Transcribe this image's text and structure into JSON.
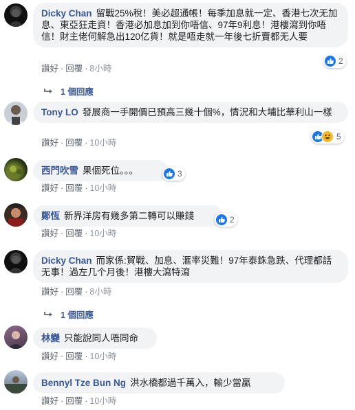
{
  "comments": [
    {
      "author": "Dicky Chan",
      "text": "留戰25%稅！美必超通帳！每季加息就一定、香港七次无加息、東亞狂走資！香港必加息加到你唔信、97年9利息！港樓瀉到你唔信！財主佬何解急出120亿貨！就是唔走就一年後七折賣都无人要",
      "like": "讚好",
      "reply": "回覆",
      "time": "8小時",
      "reactions": {
        "icons": [
          "like-icon"
        ],
        "count": "2"
      },
      "replies": "1 個回應"
    },
    {
      "author": "Tony LO",
      "text": "發展商一手開價已預高三幾十個%，情況和大埔比華利山一樣",
      "like": "讚好",
      "reply": "回覆",
      "time": "10小時",
      "reactions": {
        "icons": [
          "like-icon",
          "haha-icon"
        ],
        "count": "5"
      }
    },
    {
      "author": "西門吹雪",
      "text": "果個死位。。。",
      "like": "讚好",
      "reply": "回覆",
      "time": "10小時",
      "reactions": {
        "icons": [
          "like-icon"
        ],
        "count": "3"
      }
    },
    {
      "author": "鄭恆",
      "text": "新界洋房有幾多第二轉可以賺錢",
      "like": "讚好",
      "reply": "回覆",
      "time": "10小時",
      "reactions": {
        "icons": [
          "like-icon"
        ],
        "count": "2"
      }
    },
    {
      "author": "Dicky Chan",
      "text": "而家係:貿戰、加息、滙率災難！97年泰銖急跌、代理都話无事！過左几个月後！港樓大瀉特瀉",
      "like": "讚好",
      "reply": "回覆",
      "time": "8小時",
      "replies": "1 個回應"
    },
    {
      "author": "林變",
      "text": "只能說同人唔同命",
      "like": "讚好",
      "reply": "回覆",
      "time": "10小時"
    },
    {
      "author": "Bennyl Tze Bun Ng",
      "text": "洪水橋都過千萬入，輸少當贏",
      "like": "讚好",
      "reply": "回覆",
      "time": "10小時"
    }
  ],
  "colors": {
    "author": "#385898",
    "bubble": "#f2f3f5",
    "meta": "#606770",
    "like": "#1877f2",
    "haha": "#f7b928"
  }
}
